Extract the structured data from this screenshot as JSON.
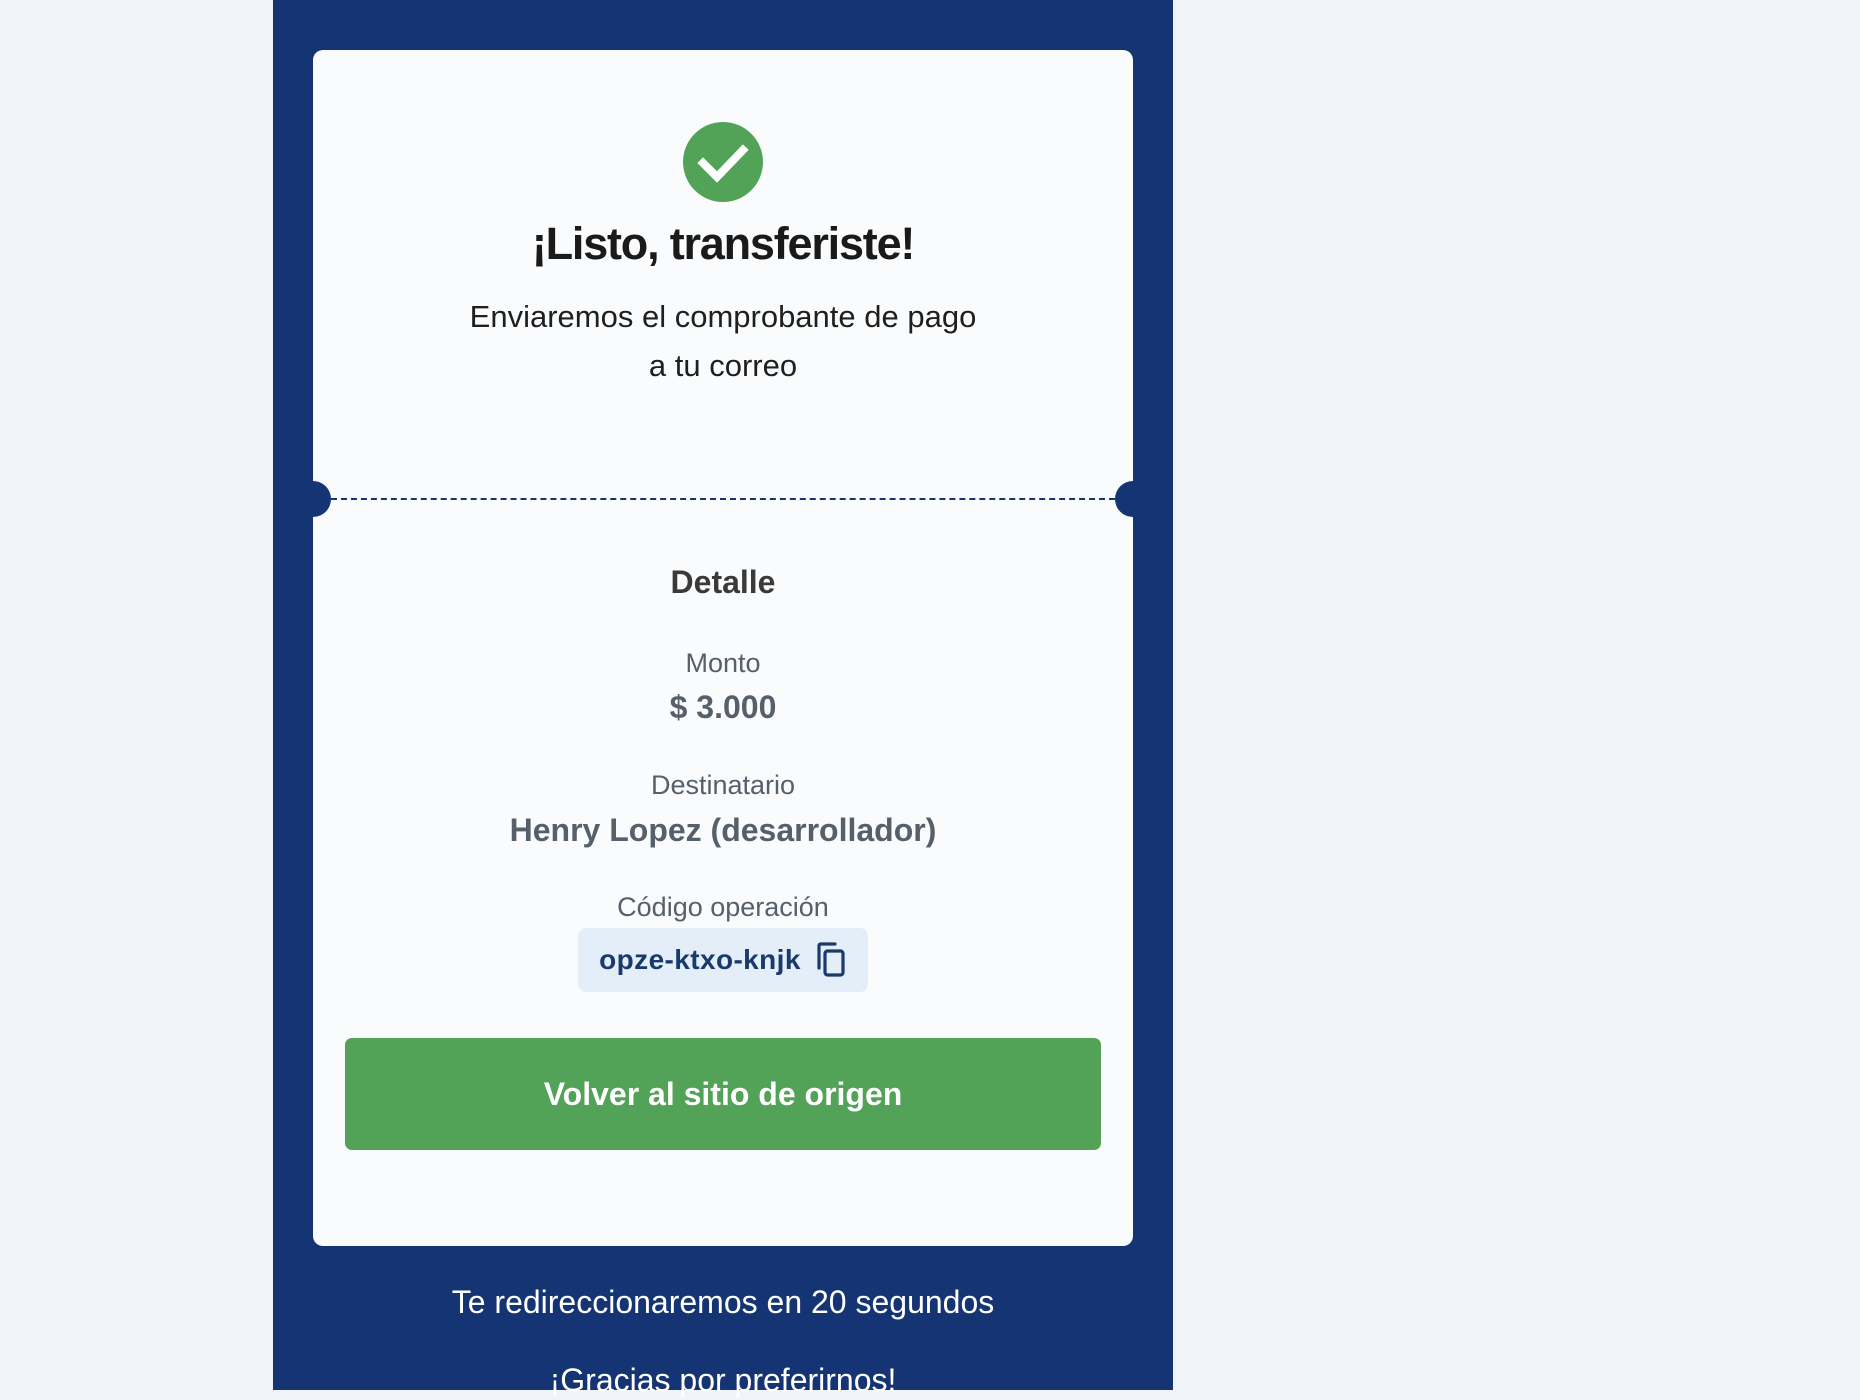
{
  "success": {
    "icon": "check-circle-icon",
    "title": "¡Listo, transferiste!",
    "subtitle_line1": "Enviaremos el comprobante de pago",
    "subtitle_line2": "a tu correo"
  },
  "detail": {
    "heading": "Detalle",
    "amount_label": "Monto",
    "amount_value": "$ 3.000",
    "recipient_label": "Destinatario",
    "recipient_value": "Henry Lopez (desarrollador)",
    "code_label": "Código operación",
    "code_value": "opze-ktxo-knjk",
    "copy_icon": "copy-icon"
  },
  "actions": {
    "return_button": "Volver al sitio de origen"
  },
  "footer": {
    "redirect_text": "Te redireccionaremos en 20 segundos",
    "thanks_text": "¡Gracias por preferirnos!"
  },
  "colors": {
    "panel_background": "#153473",
    "page_background": "#f0f4f8",
    "card_background": "#fafbfc",
    "success_green": "#52a257",
    "code_chip_background": "#e3eef9",
    "code_text": "#1a3a6b"
  }
}
